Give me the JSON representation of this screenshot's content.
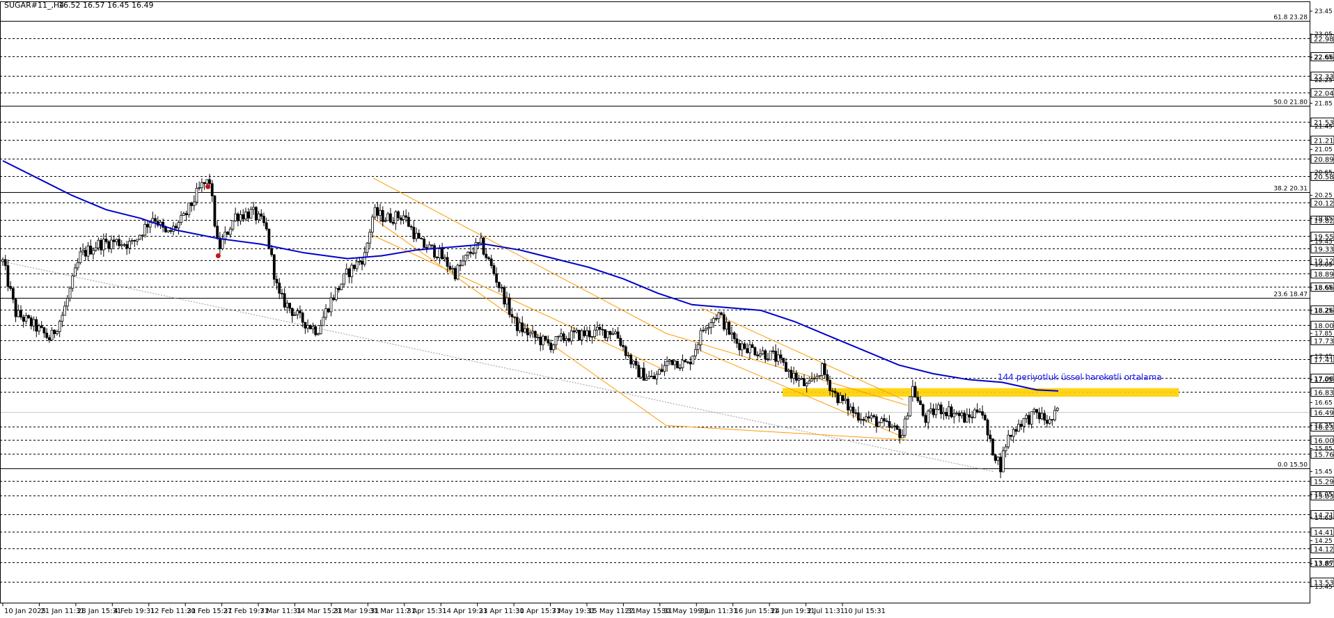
{
  "header": {
    "symbol": "SUGAR#11_,H4",
    "ohlc": "16.52 16.57 16.45 16.49"
  },
  "chart_data": {
    "type": "candlestick",
    "title": "SUGAR#11_,H4",
    "ylim": [
      13.45,
      23.45
    ],
    "x_tick_labels": [
      "10 Jan 2025",
      "21 Jan 11:31",
      "28 Jan 15:31",
      "4 Feb 19:31",
      "12 Feb 11:31",
      "20 Feb 15:31",
      "27 Feb 19:31",
      "7 Mar 11:31",
      "14 Mar 15:31",
      "21 Mar 19:31",
      "31 Mar 11:31",
      "7 Apr 15:31",
      "14 Apr 19:31",
      "23 Apr 11:31",
      "30 Apr 15:31",
      "7 May 19:31",
      "15 May 11:31",
      "22 May 15:31",
      "30 May 19:31",
      "9 Jun 11:31",
      "16 Jun 15:31",
      "24 Jun 19:31",
      "2 Jul 11:31",
      "10 Jul 15:31"
    ],
    "y_axis_labels": [
      "23.45",
      "23.05",
      "22.65",
      "22.25",
      "21.85",
      "21.45",
      "21.05",
      "20.65",
      "20.25",
      "19.85",
      "19.45",
      "19.05",
      "18.65",
      "18.25",
      "17.85",
      "17.45",
      "17.05",
      "16.65",
      "16.25",
      "15.85",
      "15.45",
      "15.05",
      "14.65",
      "14.25",
      "13.85",
      "13.45"
    ],
    "price_levels": [
      "22.98",
      "22.66",
      "22.33",
      "22.04",
      "21.53",
      "21.21",
      "20.89",
      "20.58",
      "20.12",
      "19.82",
      "19.55",
      "19.33",
      "19.12",
      "18.89",
      "18.66",
      "18.26",
      "18.00",
      "17.73",
      "17.41",
      "17.08",
      "16.83",
      "16.49",
      "16.23",
      "16.00",
      "15.76",
      "15.29",
      "15.03",
      "14.71",
      "14.41",
      "14.12",
      "13.87",
      "13.53"
    ],
    "fibonacci": [
      {
        "label": "61.8 23.28",
        "value": 23.28
      },
      {
        "label": "50.0 21.80",
        "value": 21.8
      },
      {
        "label": "38.2 20.31",
        "value": 20.31
      },
      {
        "label": "23.6 18.47",
        "value": 18.47
      },
      {
        "label": "0.0 15.50",
        "value": 15.5
      }
    ],
    "current_price": "16.49",
    "annotation": "144 periyotluk üssel hareketli ortalama",
    "resistance_zone": [
      16.75,
      16.9
    ],
    "price_path": [
      [
        0,
        19.1
      ],
      [
        15,
        18.2
      ],
      [
        35,
        18.0
      ],
      [
        55,
        17.75
      ],
      [
        70,
        18.2
      ],
      [
        90,
        19.2
      ],
      [
        110,
        19.4
      ],
      [
        130,
        19.45
      ],
      [
        150,
        19.4
      ],
      [
        175,
        19.9
      ],
      [
        190,
        19.55
      ],
      [
        210,
        19.85
      ],
      [
        230,
        20.4
      ],
      [
        240,
        20.5
      ],
      [
        250,
        19.3
      ],
      [
        270,
        19.9
      ],
      [
        290,
        19.95
      ],
      [
        305,
        19.7
      ],
      [
        320,
        18.5
      ],
      [
        345,
        18.1
      ],
      [
        365,
        17.9
      ],
      [
        380,
        18.4
      ],
      [
        400,
        18.9
      ],
      [
        420,
        19.2
      ],
      [
        430,
        19.95
      ],
      [
        445,
        19.85
      ],
      [
        465,
        19.9
      ],
      [
        485,
        19.4
      ],
      [
        505,
        19.25
      ],
      [
        525,
        18.9
      ],
      [
        545,
        19.3
      ],
      [
        555,
        19.4
      ],
      [
        570,
        18.9
      ],
      [
        595,
        18.0
      ],
      [
        615,
        17.8
      ],
      [
        635,
        17.65
      ],
      [
        655,
        17.8
      ],
      [
        680,
        17.85
      ],
      [
        710,
        17.9
      ],
      [
        735,
        17.2
      ],
      [
        755,
        17.05
      ],
      [
        775,
        17.4
      ],
      [
        795,
        17.3
      ],
      [
        815,
        18.0
      ],
      [
        830,
        18.2
      ],
      [
        850,
        17.7
      ],
      [
        875,
        17.55
      ],
      [
        895,
        17.45
      ],
      [
        915,
        17.15
      ],
      [
        935,
        16.9
      ],
      [
        950,
        17.25
      ],
      [
        965,
        16.8
      ],
      [
        990,
        16.45
      ],
      [
        1010,
        16.35
      ],
      [
        1030,
        16.2
      ],
      [
        1045,
        16.1
      ],
      [
        1055,
        16.95
      ],
      [
        1070,
        16.35
      ],
      [
        1085,
        16.55
      ],
      [
        1100,
        16.5
      ],
      [
        1120,
        16.35
      ],
      [
        1135,
        16.6
      ],
      [
        1145,
        15.95
      ],
      [
        1158,
        15.55
      ],
      [
        1165,
        16.0
      ],
      [
        1180,
        16.3
      ],
      [
        1200,
        16.45
      ],
      [
        1215,
        16.3
      ],
      [
        1225,
        16.5
      ]
    ],
    "ema144": [
      [
        0,
        20.85
      ],
      [
        40,
        20.55
      ],
      [
        80,
        20.25
      ],
      [
        120,
        20.0
      ],
      [
        160,
        19.85
      ],
      [
        200,
        19.65
      ],
      [
        250,
        19.5
      ],
      [
        300,
        19.4
      ],
      [
        350,
        19.25
      ],
      [
        400,
        19.15
      ],
      [
        440,
        19.2
      ],
      [
        480,
        19.3
      ],
      [
        520,
        19.35
      ],
      [
        560,
        19.4
      ],
      [
        600,
        19.3
      ],
      [
        640,
        19.15
      ],
      [
        680,
        19.0
      ],
      [
        720,
        18.8
      ],
      [
        760,
        18.55
      ],
      [
        800,
        18.35
      ],
      [
        840,
        18.3
      ],
      [
        880,
        18.25
      ],
      [
        920,
        18.05
      ],
      [
        960,
        17.8
      ],
      [
        1000,
        17.55
      ],
      [
        1040,
        17.3
      ],
      [
        1080,
        17.15
      ],
      [
        1120,
        17.05
      ],
      [
        1160,
        17.0
      ],
      [
        1200,
        16.87
      ],
      [
        1225,
        16.85
      ]
    ],
    "channels": [
      {
        "upper": [
          [
            430,
            20.55
          ],
          [
            770,
            17.85
          ],
          [
            1050,
            16.6
          ]
        ],
        "lower": [
          [
            430,
            19.85
          ],
          [
            770,
            16.25
          ],
          [
            1050,
            16.0
          ]
        ]
      }
    ]
  }
}
